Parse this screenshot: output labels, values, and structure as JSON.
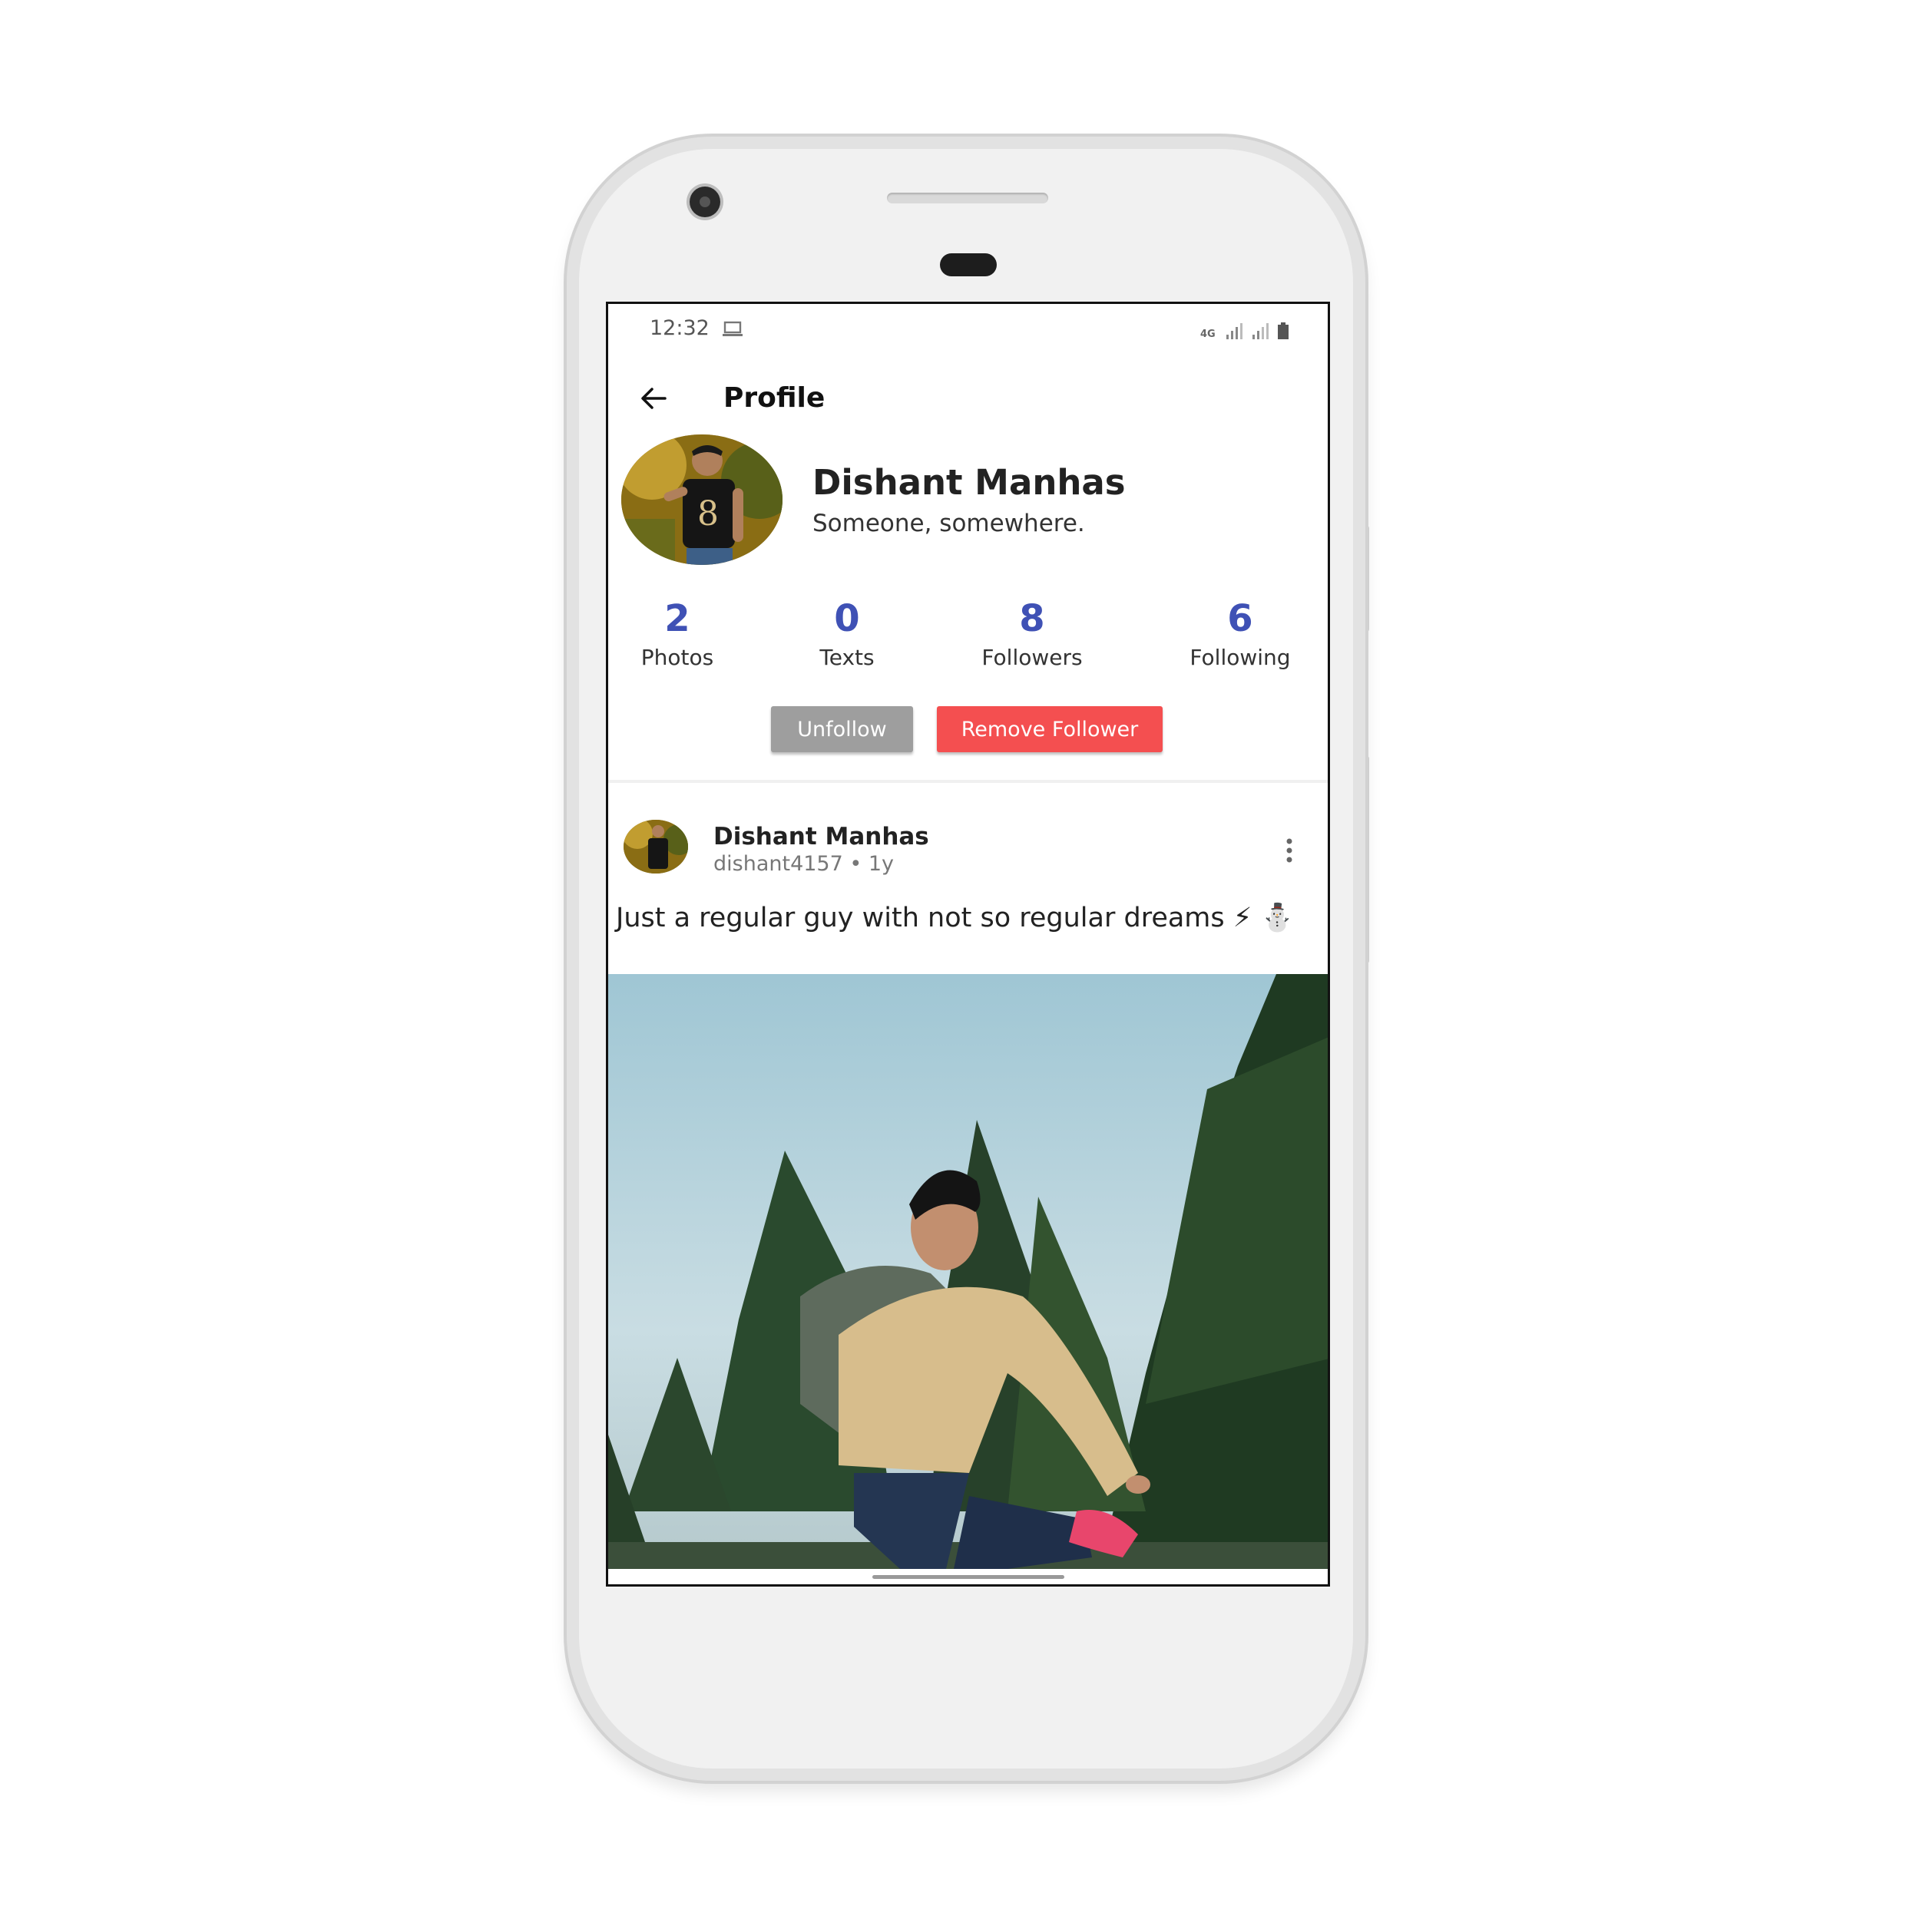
{
  "status_bar": {
    "time": "12:32",
    "network": "4G"
  },
  "app_bar": {
    "title": "Profile"
  },
  "profile": {
    "name": "Dishant Manhas",
    "bio": "Someone, somewhere."
  },
  "stats": [
    {
      "value": "2",
      "label": "Photos"
    },
    {
      "value": "0",
      "label": "Texts"
    },
    {
      "value": "8",
      "label": "Followers"
    },
    {
      "value": "6",
      "label": "Following"
    }
  ],
  "actions": {
    "unfollow": "Unfollow",
    "remove_follower": "Remove Follower"
  },
  "post": {
    "author": "Dishant Manhas",
    "meta": "dishant4157 • 1y",
    "text": "Just a regular guy with not so regular dreams ⚡ ⛄"
  },
  "colors": {
    "accent": "#3f51b5",
    "unfollow_button": "#9e9e9e",
    "remove_button": "#f44f50"
  }
}
